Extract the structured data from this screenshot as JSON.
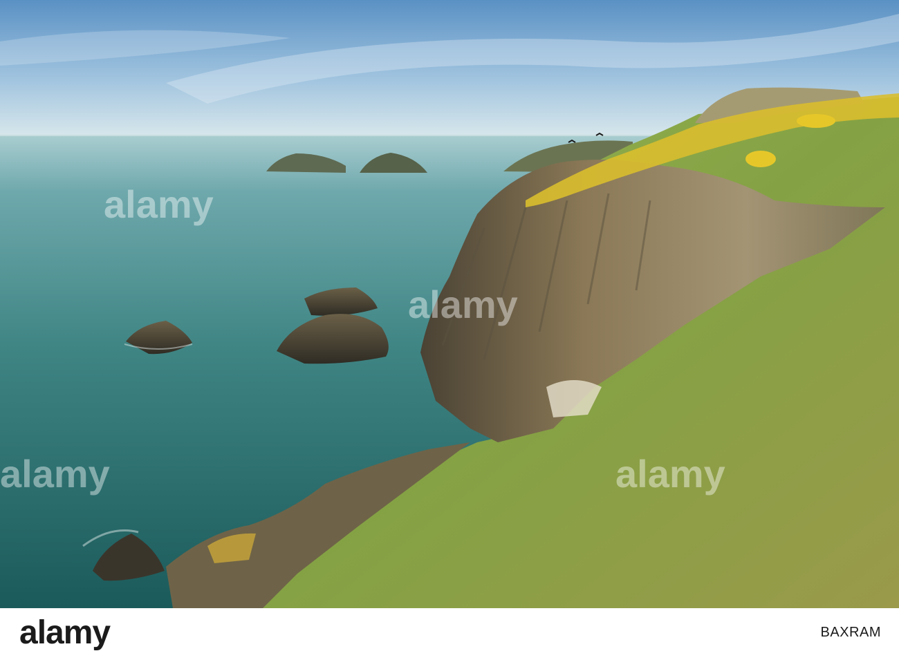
{
  "watermark": {
    "text": "alamy"
  },
  "footer": {
    "logo": "alamy",
    "image_id": "BAXRAM"
  },
  "colors": {
    "sky_top": "#5d93c6",
    "sky_horizon": "#d6e6ec",
    "sea_far": "#8ebfc2",
    "sea_near": "#1d5d5c",
    "grass": "#8aa547",
    "gorse": "#e2c22a",
    "cliff_rock": "#7a6a4c"
  }
}
